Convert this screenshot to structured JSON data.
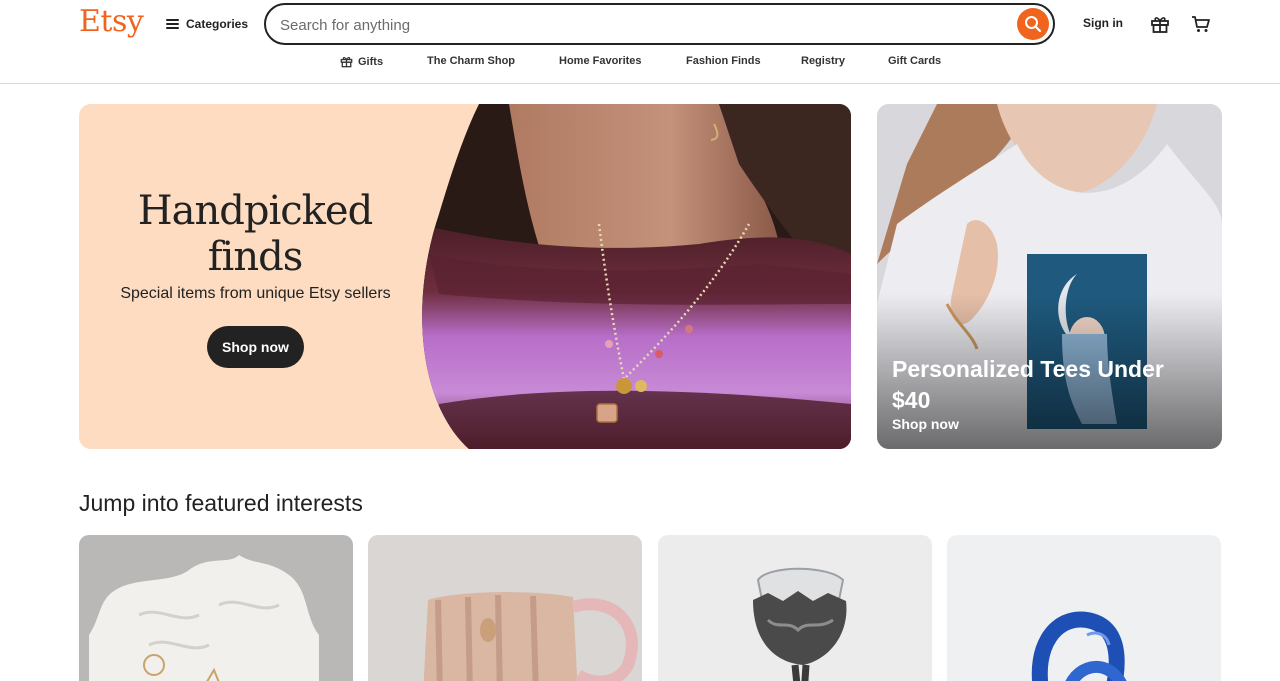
{
  "header": {
    "logo_text": "Etsy",
    "categories_label": "Categories",
    "search_placeholder": "Search for anything",
    "signin_label": "Sign in"
  },
  "nav": {
    "items": [
      {
        "label": "Gifts",
        "icon": "gift-icon"
      },
      {
        "label": "The Charm Shop"
      },
      {
        "label": "Home Favorites"
      },
      {
        "label": "Fashion Finds"
      },
      {
        "label": "Registry"
      },
      {
        "label": "Gift Cards"
      }
    ]
  },
  "hero": {
    "title": "Handpicked finds",
    "subtitle": "Special items from unique Etsy sellers",
    "cta": "Shop now"
  },
  "promo": {
    "title": "Personalized Tees Under $40",
    "cta": "Shop now"
  },
  "featured": {
    "title": "Jump into featured interests",
    "cards": [
      {
        "name": "white-ceramic-trinket-dish"
      },
      {
        "name": "pink-ceramic-mug"
      },
      {
        "name": "dark-ornate-goblet"
      },
      {
        "name": "blue-knot-sculpture"
      }
    ]
  },
  "colors": {
    "brand": "#f1641e",
    "hero_bg": "#fddcc1",
    "button_dark": "#222222"
  }
}
